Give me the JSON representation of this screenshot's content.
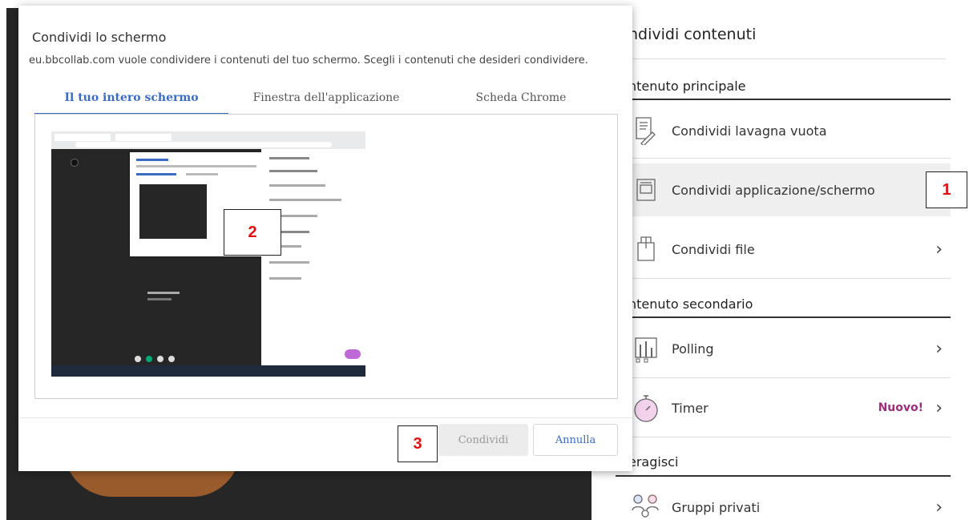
{
  "panel": {
    "title": "ndividi contenuti",
    "sections": [
      {
        "heading": "ntenuto principale"
      },
      {
        "heading": "ntenuto secondario"
      },
      {
        "heading": "eragisci"
      }
    ],
    "items": [
      {
        "label": "Condividi lavagna vuota",
        "icon": "whiteboard-icon"
      },
      {
        "label": "Condividi applicazione/schermo",
        "icon": "screen-share-icon",
        "selected": true
      },
      {
        "label": "Condividi file",
        "icon": "file-icon",
        "chevron": "›"
      },
      {
        "label": "Polling",
        "icon": "polling-icon",
        "chevron": "›"
      },
      {
        "label": "Timer",
        "icon": "timer-icon",
        "badge": "Nuovo!",
        "chevron": "›"
      },
      {
        "label": "Gruppi privati",
        "icon": "groups-icon",
        "chevron": "›"
      }
    ]
  },
  "dialog": {
    "title": "Condividi lo schermo",
    "description": "eu.bbcollab.com vuole condividere i contenuti del tuo schermo. Scegli i contenuti che desideri condividere.",
    "tabs": [
      "Il tuo intero schermo",
      "Finestra dell'applicazione",
      "Scheda Chrome"
    ],
    "share_label": "Condividi",
    "cancel_label": "Annulla"
  },
  "callouts": [
    "1",
    "2",
    "3"
  ],
  "colors": {
    "accent": "#3b6cc2",
    "badge": "#9b2f7a",
    "callout": "#e01010",
    "dark_bg": "#262626"
  }
}
